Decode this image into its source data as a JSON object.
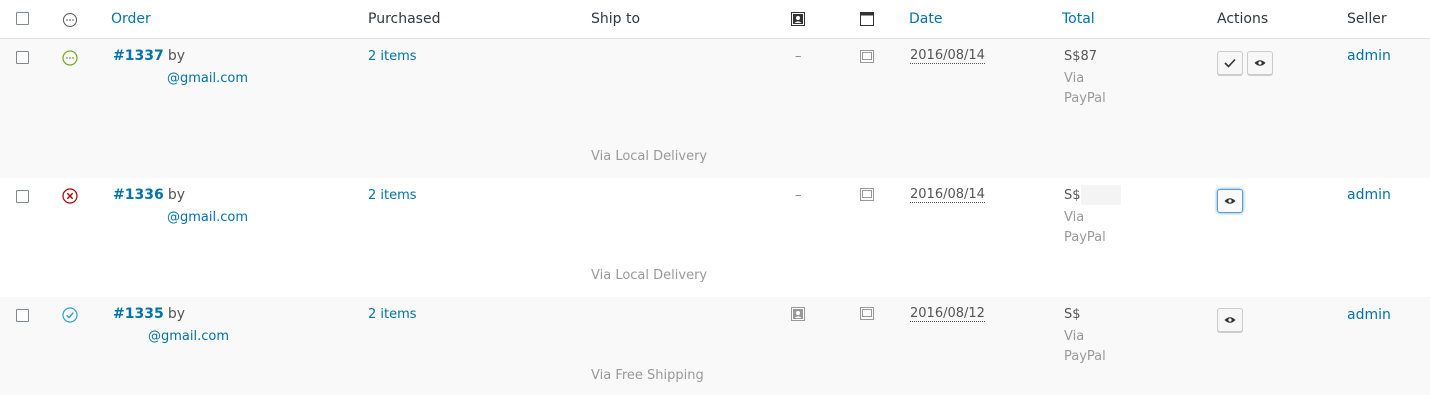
{
  "header": {
    "order": "Order",
    "purchased": "Purchased",
    "ship_to": "Ship to",
    "date": "Date",
    "total": "Total",
    "actions": "Actions",
    "seller": "Seller",
    "status_icon": "status-ellipsis-icon",
    "billing_icon": "billing-address-icon",
    "notes_icon": "notes-window-icon"
  },
  "orders": [
    {
      "status": "processing",
      "status_color": "#73a724",
      "number": "#1337",
      "by": "by",
      "email": "@gmail.com",
      "purchased": "2 items",
      "shipping_method": "Via Local Delivery",
      "billing": "–",
      "date": "2016/08/14",
      "total": "S$87",
      "via_line1": "Via",
      "via_line2": "PayPal",
      "actions": [
        "complete",
        "view"
      ],
      "seller": "admin"
    },
    {
      "status": "cancelled",
      "status_color": "#a00",
      "number": "#1336",
      "by": "by",
      "email": "@gmail.com",
      "purchased": "2 items",
      "shipping_method": "Via Local Delivery",
      "billing": "–",
      "date": "2016/08/14",
      "total": "S$",
      "via_line1": "Via",
      "via_line2": "PayPal",
      "actions": [
        "view"
      ],
      "seller": "admin"
    },
    {
      "status": "completed",
      "status_color": "#2ea2cc",
      "number": "#1335",
      "by": "by",
      "email": "@gmail.com",
      "purchased": "2 items",
      "shipping_method": "Via Free Shipping",
      "billing": "billing-address-icon",
      "date": "2016/08/12",
      "total": "S$",
      "via_line1": "Via",
      "via_line2": "PayPal",
      "actions": [
        "view"
      ],
      "seller": "admin"
    }
  ]
}
